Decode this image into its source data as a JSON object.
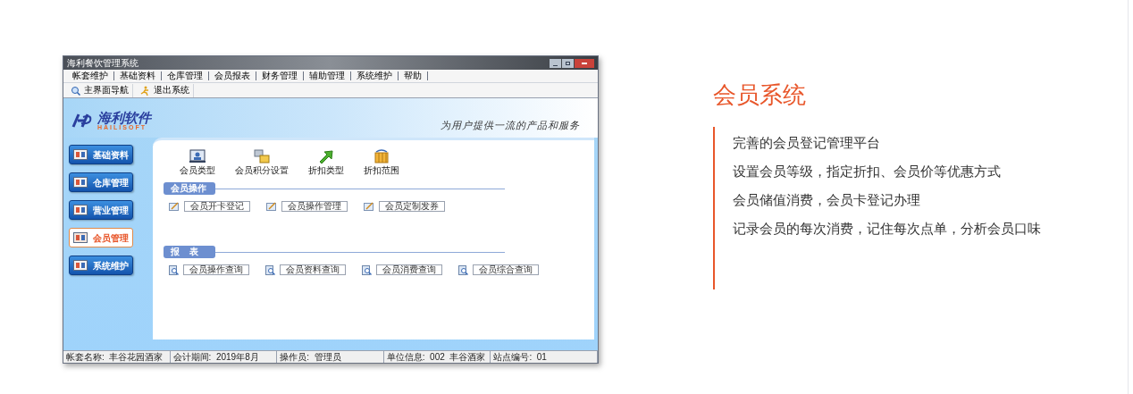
{
  "app_window": {
    "title": "海利餐饮管理系统",
    "menu": [
      "帐套维护",
      "基础资料",
      "仓库管理",
      "会员报表",
      "财务管理",
      "辅助管理",
      "系统维护",
      "帮助"
    ],
    "toolbar": [
      "主界面导航",
      "退出系统"
    ],
    "logo": {
      "text": "海利软件",
      "subtext": "HAILISOFT"
    },
    "slogan": "为用户提供一流的产品和服务",
    "sidebar": [
      {
        "label": "基础资料",
        "selected": false
      },
      {
        "label": "仓库管理",
        "selected": false
      },
      {
        "label": "营业管理",
        "selected": false
      },
      {
        "label": "会员管理",
        "selected": true
      },
      {
        "label": "系统维护",
        "selected": false
      }
    ],
    "quick_icons": [
      {
        "label": "会员类型",
        "kind": "card"
      },
      {
        "label": "会员积分设置",
        "kind": "stack"
      },
      {
        "label": "折扣类型",
        "kind": "arrow"
      },
      {
        "label": "折扣范围",
        "kind": "grid"
      }
    ],
    "sections": [
      {
        "title": "会员操作",
        "kind": "edit",
        "items": [
          "会员开卡登记",
          "会员操作管理",
          "会员定制发券"
        ]
      },
      {
        "title": "报    表",
        "kind": "query",
        "items": [
          "会员操作查询",
          "会员资料查询",
          "会员消费查询",
          "会员综合查询"
        ]
      }
    ],
    "status_bar": [
      "帐套名称:  丰谷花园酒家",
      "会计期间:  2019年8月",
      "操作员:  管理员",
      "单位信息:  002  丰谷酒家",
      "站点编号:  01"
    ]
  },
  "feature": {
    "title": "会员系统",
    "lines": [
      "完善的会员登记管理平台",
      "设置会员等级，指定折扣、会员价等优惠方式",
      "会员储值消费，会员卡登记办理",
      "记录会员的每次消费，记住每次点单，分析会员口味"
    ]
  }
}
